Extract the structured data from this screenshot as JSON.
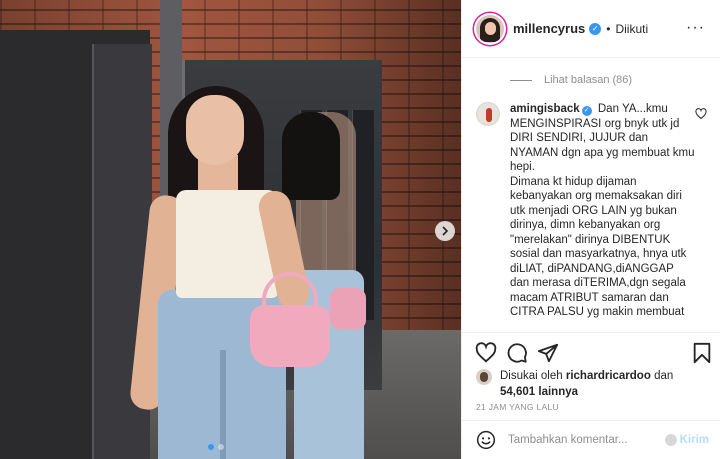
{
  "post": {
    "username": "millencyrus",
    "follow_separator": "•",
    "follow_status": "Diikuti",
    "more_icon": "more-horizontal-icon"
  },
  "comments": {
    "view_replies": "Lihat balasan (86)",
    "item": {
      "username": "amingisback",
      "text": "Dan YA...kmu\nMENGINSPIRASI org bnyk utk jd DIRI SENDIRI, JUJUR dan NYAMAN dgn apa yg membuat kmu hepi.\nDimana kt hidup dijaman kebanyakan org memaksakan diri utk menjadi ORG LAIN yg bukan dirinya, dimn kebanyakan org \"merelakan\" dirinya DIBENTUK sosial dan masyarkatnya, hnya utk diLIAT, diPANDANG,diANGGAP dan merasa diTERIMA,dgn segala macam ATRIBUT samaran dan CITRA PALSU yg makin membuat"
    }
  },
  "actions": {
    "like_icon": "heart-icon",
    "comment_icon": "comment-icon",
    "share_icon": "share-icon",
    "save_icon": "bookmark-icon"
  },
  "likes": {
    "prefix": "Disukai oleh",
    "user": "richardricardoo",
    "middle": "dan",
    "count": "54,601",
    "suffix": "lainnya"
  },
  "timestamp": "21 JAM YANG LALU",
  "add_comment": {
    "placeholder": "Tambahkan komentar...",
    "post_label": "Kirim"
  },
  "colors": {
    "accent": "#3897f0",
    "post_disabled": "#b2dffc",
    "muted": "#8e8e8e"
  }
}
